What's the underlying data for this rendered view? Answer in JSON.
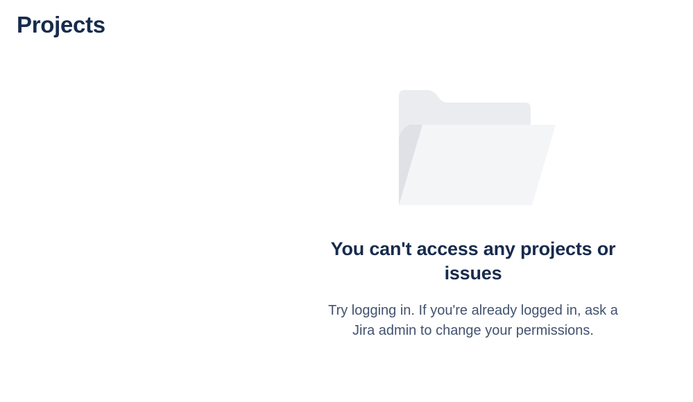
{
  "page": {
    "title": "Projects"
  },
  "empty_state": {
    "illustration": "folder-icon",
    "heading": "You can't access any projects or issues",
    "message": "Try logging in. If you're already logged in, ask a Jira admin to change your permissions."
  },
  "colors": {
    "text_primary": "#172b4d",
    "text_secondary": "#42526e",
    "folder_back": "#ebecf0",
    "folder_front": "#f4f5f7",
    "folder_shadow": "#dfe1e6"
  }
}
